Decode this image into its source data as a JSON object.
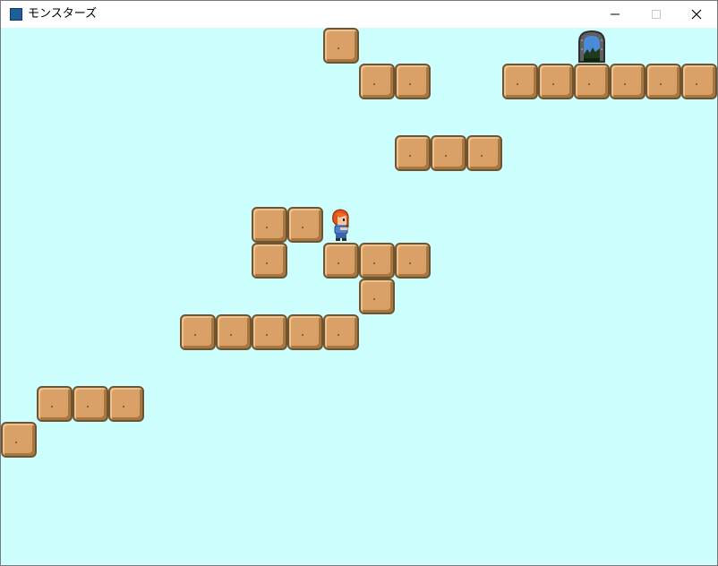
{
  "window": {
    "title": "モンスターズ",
    "minimize_glyph": "—",
    "maximize_glyph": "☐",
    "close_glyph": "✕"
  },
  "game": {
    "background_color": "#ccfffe",
    "tile_color": "#d9a067",
    "tile_outline_color": "#6e5532",
    "grid_cols": 20,
    "grid_rows": 15,
    "tiles": [
      {
        "col": 9,
        "row": 0
      },
      {
        "col": 10,
        "row": 1
      },
      {
        "col": 11,
        "row": 1
      },
      {
        "col": 14,
        "row": 1
      },
      {
        "col": 15,
        "row": 1
      },
      {
        "col": 16,
        "row": 1
      },
      {
        "col": 17,
        "row": 1
      },
      {
        "col": 18,
        "row": 1
      },
      {
        "col": 19,
        "row": 1
      },
      {
        "col": 11,
        "row": 3
      },
      {
        "col": 12,
        "row": 3
      },
      {
        "col": 13,
        "row": 3
      },
      {
        "col": 7,
        "row": 5
      },
      {
        "col": 8,
        "row": 5
      },
      {
        "col": 7,
        "row": 6
      },
      {
        "col": 9,
        "row": 6
      },
      {
        "col": 10,
        "row": 6
      },
      {
        "col": 11,
        "row": 6
      },
      {
        "col": 10,
        "row": 7
      },
      {
        "col": 5,
        "row": 8
      },
      {
        "col": 6,
        "row": 8
      },
      {
        "col": 7,
        "row": 8
      },
      {
        "col": 8,
        "row": 8
      },
      {
        "col": 9,
        "row": 8
      },
      {
        "col": 1,
        "row": 10
      },
      {
        "col": 2,
        "row": 10
      },
      {
        "col": 3,
        "row": 10
      },
      {
        "col": 0,
        "row": 11
      }
    ],
    "door": {
      "col": 16,
      "row": 0,
      "icon": "stone-archway-door-icon"
    },
    "player": {
      "col": 9,
      "row": 5,
      "icon": "red-haired-hero-icon"
    }
  }
}
